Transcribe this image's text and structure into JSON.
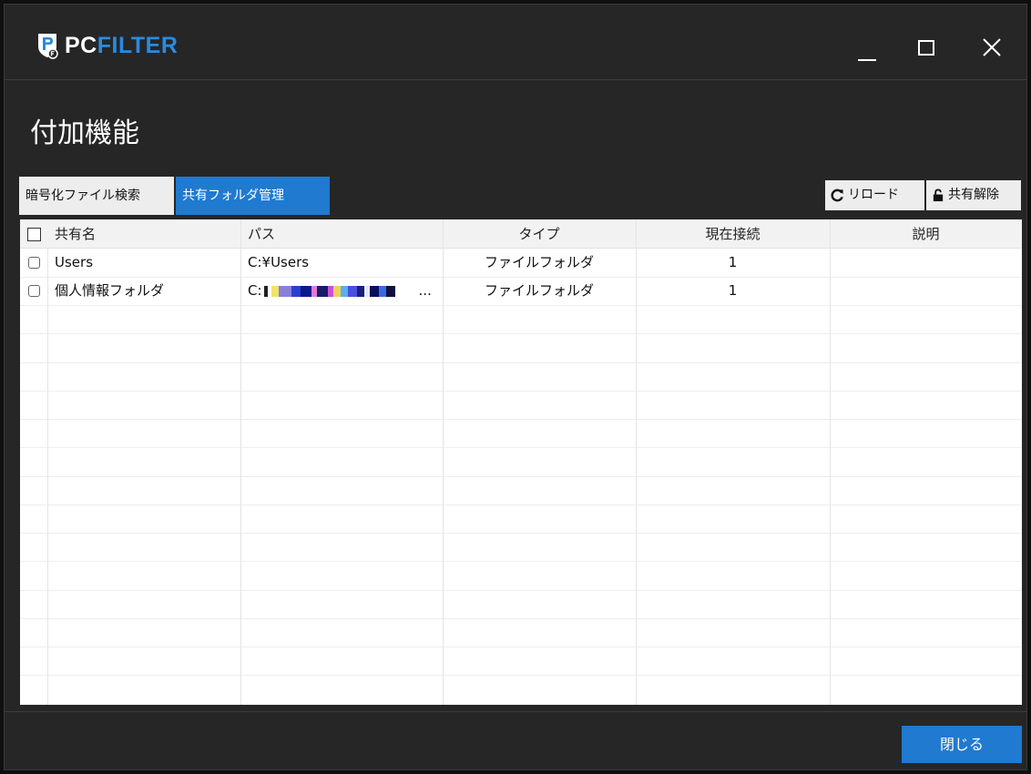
{
  "app": {
    "brand_pc": "PC",
    "brand_filter": "FILTER",
    "title": "付加機能"
  },
  "tabs": [
    {
      "label": "暗号化ファイル検索",
      "active": false
    },
    {
      "label": "共有フォルダ管理",
      "active": true
    }
  ],
  "toolbar": {
    "reload_label": "リロード",
    "unshare_label": "共有解除"
  },
  "table": {
    "columns": [
      "共有名",
      "パス",
      "タイプ",
      "現在接続",
      "説明"
    ],
    "rows": [
      {
        "name": "Users",
        "path": "C:¥Users",
        "type": "ファイルフォルダ",
        "connections": "1",
        "description": ""
      },
      {
        "name": "個人情報フォルダ",
        "path": "C:",
        "path_suffix": "...",
        "type": "ファイルフォルダ",
        "connections": "1",
        "description": ""
      }
    ]
  },
  "footer": {
    "close_label": "閉じる"
  },
  "colors": {
    "accent": "#1f7ad0",
    "background": "#262626"
  }
}
